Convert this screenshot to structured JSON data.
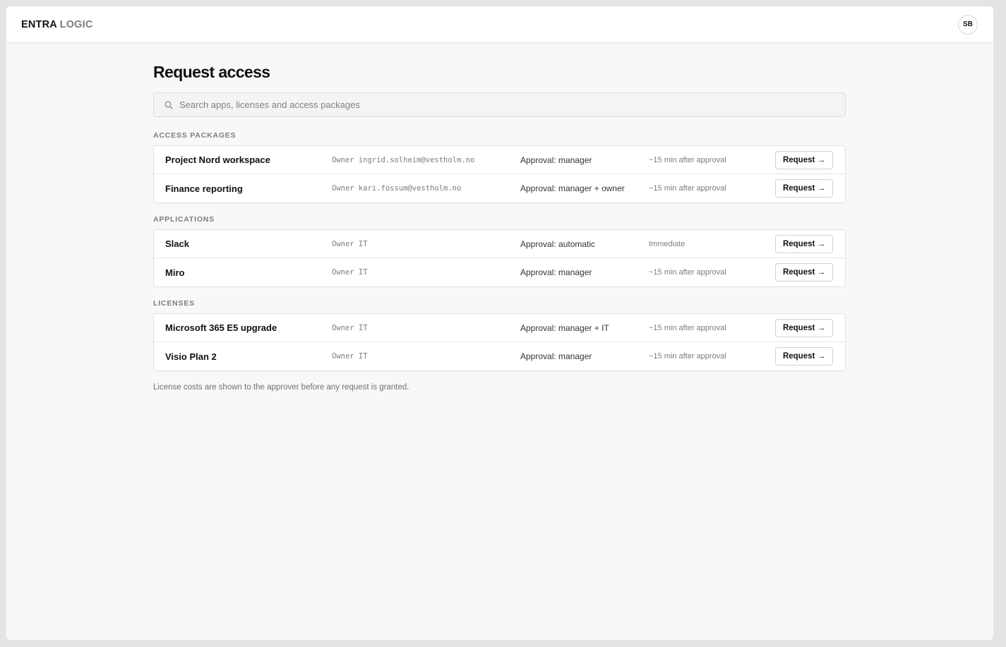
{
  "brand": {
    "part1": "ENTRA",
    "part2": "LOGIC"
  },
  "user": {
    "initials": "SB"
  },
  "page": {
    "title": "Request access"
  },
  "search": {
    "placeholder": "Search apps, licenses and access packages"
  },
  "sections": [
    {
      "title": "Access packages",
      "items": [
        {
          "name": "Project Nord workspace",
          "owner": "Owner ingrid.solheim@vestholm.no",
          "approval": "Approval: manager",
          "eta": "~15 min after approval",
          "button": "Request →"
        },
        {
          "name": "Finance reporting",
          "owner": "Owner kari.fossum@vestholm.no",
          "approval": "Approval: manager + owner",
          "eta": "~15 min after approval",
          "button": "Request →"
        }
      ]
    },
    {
      "title": "Applications",
      "items": [
        {
          "name": "Slack",
          "owner": "Owner IT",
          "approval": "Approval: automatic",
          "eta": "Immediate",
          "button": "Request →"
        },
        {
          "name": "Miro",
          "owner": "Owner IT",
          "approval": "Approval: manager",
          "eta": "~15 min after approval",
          "button": "Request →"
        }
      ]
    },
    {
      "title": "Licenses",
      "items": [
        {
          "name": "Microsoft 365 E5 upgrade",
          "owner": "Owner IT",
          "approval": "Approval: manager + IT",
          "eta": "~15 min after approval",
          "button": "Request →"
        },
        {
          "name": "Visio Plan 2",
          "owner": "Owner IT",
          "approval": "Approval: manager",
          "eta": "~15 min after approval",
          "button": "Request →"
        }
      ]
    }
  ],
  "footnote": "License costs are shown to the approver before any request is granted."
}
